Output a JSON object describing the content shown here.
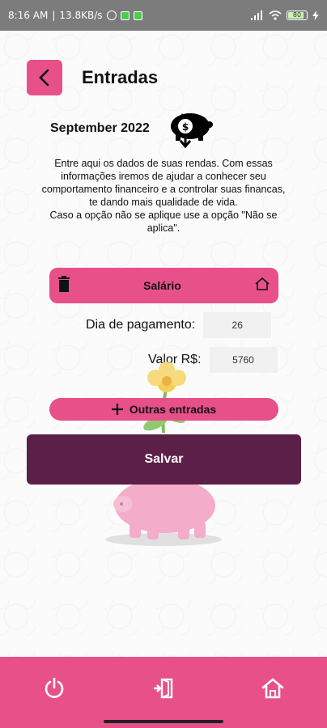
{
  "status_bar": {
    "time": "8:16 AM",
    "network_speed": "13.8KB/s",
    "battery": "80"
  },
  "header": {
    "title": "Entradas"
  },
  "month": {
    "label": "September 2022"
  },
  "intro": {
    "line1": "Entre aqui os dados de suas rendas. Com essas informações iremos de ajudar a conhecer seu comportamento financeiro e a controlar suas financas, te dando mais qualidade de vida.",
    "line2": "Caso a opção não se aplique use a opção \"Não se aplica\"."
  },
  "entry": {
    "title": "Salário",
    "payment_day_label": "Dia de pagamento:",
    "payment_day_value": "26",
    "amount_label": "Valor R$:",
    "amount_value": "5760"
  },
  "actions": {
    "other_entries_label": "Outras entradas",
    "save_label": "Salvar"
  },
  "bottom_nav": {
    "items": [
      "power-icon",
      "logout-door-icon",
      "home-icon"
    ]
  },
  "colors": {
    "accent_pink": "#e8508a",
    "save_purple": "#5c1f48",
    "status_bar": "#7c7c7c"
  }
}
